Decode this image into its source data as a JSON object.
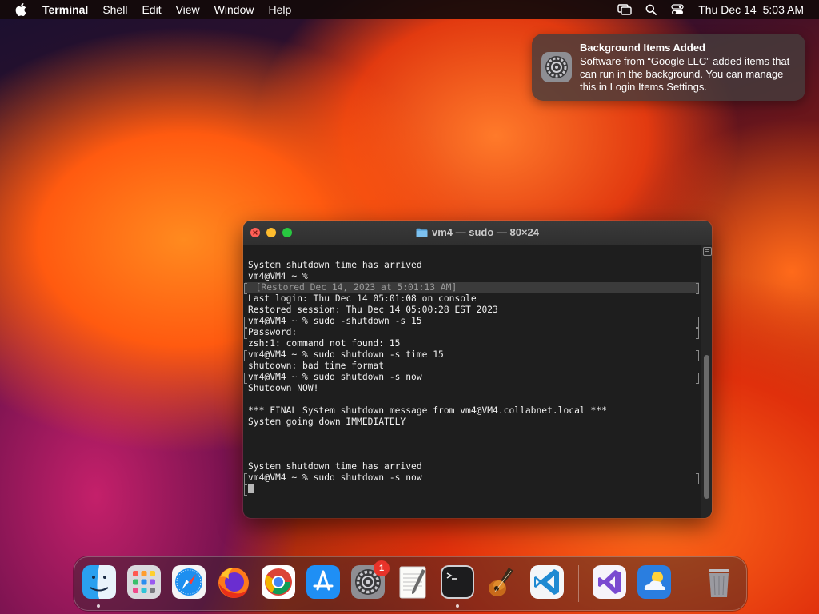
{
  "menubar": {
    "apple_icon": "apple-logo-icon",
    "app_name": "Terminal",
    "menus": [
      "Shell",
      "Edit",
      "View",
      "Window",
      "Help"
    ],
    "status_icons": [
      "screen-mirroring-icon",
      "search-icon",
      "control-center-icon"
    ],
    "date": "Thu Dec 14",
    "time": "5:03 AM"
  },
  "notification": {
    "icon": "system-settings-icon",
    "title": "Background Items Added",
    "body": "Software from “Google LLC” added items that can run in the background. You can manage this in Login Items Settings."
  },
  "terminal": {
    "title": "vm4 — sudo — 80×24",
    "lines": [
      "System shutdown time has arrived",
      "vm4@VM4 ~ %",
      "  [Restored Dec 14, 2023 at 5:01:13 AM]",
      "Last login: Thu Dec 14 05:01:08 on console",
      "Restored session: Thu Dec 14 05:00:28 EST 2023",
      "vm4@VM4 ~ % sudo -shutdown -s 15",
      "Password:",
      "zsh:1: command not found: 15",
      "vm4@VM4 ~ % sudo shutdown -s time 15",
      "shutdown: bad time format",
      "vm4@VM4 ~ % sudo shutdown -s now",
      "Shutdown NOW!",
      "",
      "*** FINAL System shutdown message from vm4@VM4.collabnet.local ***",
      "System going down IMMEDIATELY",
      "",
      "",
      "",
      "System shutdown time has arrived",
      "vm4@VM4 ~ % sudo shutdown -s now",
      ""
    ]
  },
  "dock": {
    "apps": [
      {
        "name": "Finder",
        "icon": "finder-icon",
        "running": true
      },
      {
        "name": "Launchpad",
        "icon": "launchpad-icon",
        "running": false
      },
      {
        "name": "Safari",
        "icon": "safari-icon",
        "running": false
      },
      {
        "name": "Firefox",
        "icon": "firefox-icon",
        "running": false
      },
      {
        "name": "Google Chrome",
        "icon": "chrome-icon",
        "running": false
      },
      {
        "name": "App Store",
        "icon": "app-store-icon",
        "running": false
      },
      {
        "name": "System Settings",
        "icon": "system-settings-icon",
        "running": false,
        "badge": "1"
      },
      {
        "name": "TextEdit",
        "icon": "textedit-icon",
        "running": false
      },
      {
        "name": "Terminal",
        "icon": "terminal-icon",
        "running": true
      },
      {
        "name": "Instruments",
        "icon": "instruments-icon",
        "running": false
      },
      {
        "name": "Visual Studio Code",
        "icon": "vscode-icon",
        "running": false
      },
      {
        "name": "Visual Studio",
        "icon": "visual-studio-icon",
        "running": false
      },
      {
        "name": "Weather",
        "icon": "weather-icon",
        "running": false
      },
      {
        "name": "Trash",
        "icon": "trash-icon",
        "running": false
      }
    ]
  },
  "colors": {
    "terminal_bg": "#1e1e1e",
    "close": "#ff5f57",
    "minimize": "#febc2e",
    "zoom": "#28c840",
    "badge": "#e8332a"
  }
}
